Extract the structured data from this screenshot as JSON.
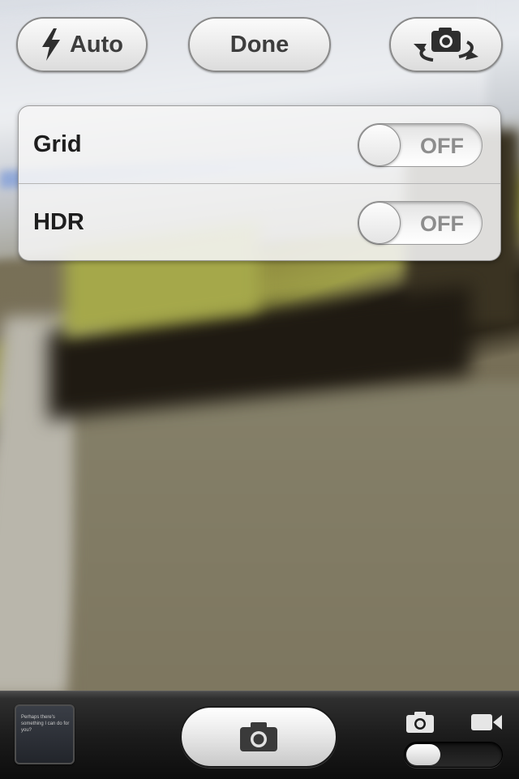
{
  "top_bar": {
    "flash_label": "Auto",
    "done_label": "Done"
  },
  "options": [
    {
      "label": "Grid",
      "state": "OFF"
    },
    {
      "label": "HDR",
      "state": "OFF"
    }
  ],
  "bottom_bar": {
    "thumbnail_text": "Perhaps there's something I can do for you?",
    "mode": "photo"
  },
  "icons": {
    "flash": "flash-icon",
    "switch_camera": "switch-camera-icon",
    "shutter": "camera-icon",
    "photo_mode": "camera-icon",
    "video_mode": "video-camera-icon"
  }
}
